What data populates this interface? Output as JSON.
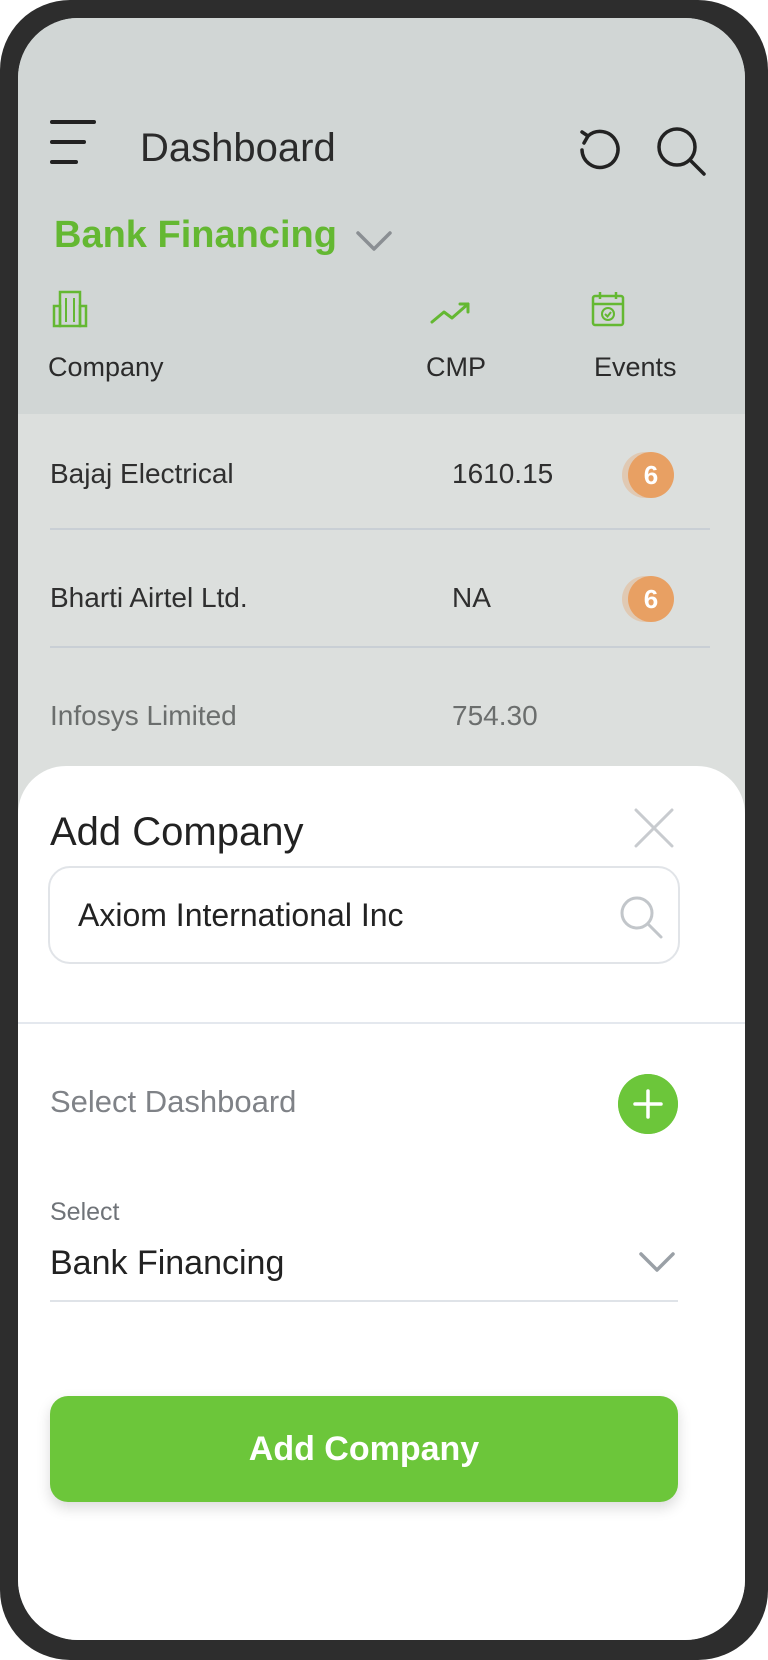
{
  "header": {
    "title": "Dashboard",
    "current_dashboard": "Bank Financing"
  },
  "columns": {
    "company": "Company",
    "cmp": "CMP",
    "events": "Events"
  },
  "rows": [
    {
      "company": "Bajaj Electrical",
      "cmp": "1610.15",
      "events": "6"
    },
    {
      "company": "Bharti Airtel Ltd.",
      "cmp": "NA",
      "events": "6"
    },
    {
      "company": "Infosys Limited",
      "cmp": "754.30",
      "events": ""
    }
  ],
  "sheet": {
    "title": "Add Company",
    "search_value": "Axiom International Inc",
    "select_dashboard_label": "Select Dashboard",
    "select_caption": "Select",
    "select_value": "Bank Financing",
    "submit_label": "Add Company"
  },
  "colors": {
    "accent": "#6cc63a",
    "accent_text": "#64b832",
    "badge": "#e8a063",
    "overlay_bg": "#d3d8d7"
  },
  "icons": [
    "menu-icon",
    "refresh-icon",
    "search-icon",
    "chevron-down-icon",
    "building-icon",
    "trend-up-icon",
    "calendar-icon",
    "close-icon",
    "plus-icon"
  ]
}
